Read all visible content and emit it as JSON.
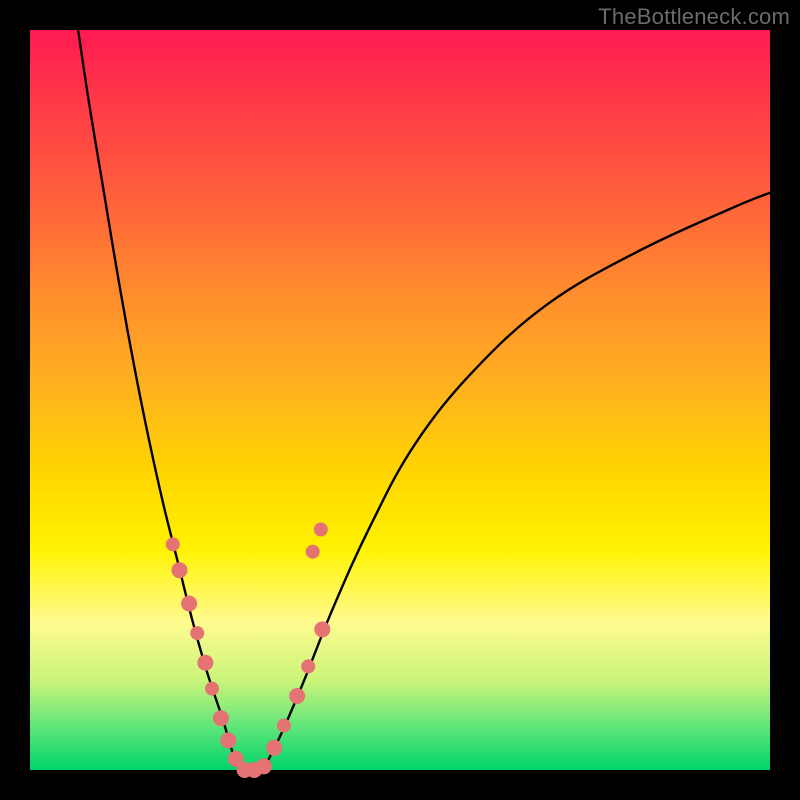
{
  "watermark": "TheBottleneck.com",
  "colors": {
    "curve_stroke": "#000000",
    "marker_fill": "#e57373",
    "marker_stroke": "#d86a6a",
    "frame": "#000000"
  },
  "chart_data": {
    "type": "line",
    "title": "",
    "xlabel": "",
    "ylabel": "",
    "x_range": [
      0,
      1
    ],
    "y_range_percent": [
      0,
      100
    ],
    "series": [
      {
        "name": "left_curve",
        "x": [
          0.065,
          0.08,
          0.1,
          0.12,
          0.14,
          0.16,
          0.18,
          0.2,
          0.22,
          0.24,
          0.26,
          0.275,
          0.285
        ],
        "y_percent": [
          100,
          90,
          78,
          66,
          55,
          45,
          36,
          28,
          20,
          13,
          7,
          2,
          0
        ]
      },
      {
        "name": "floor",
        "x": [
          0.285,
          0.3,
          0.315
        ],
        "y_percent": [
          0,
          0,
          0
        ]
      },
      {
        "name": "right_curve",
        "x": [
          0.315,
          0.34,
          0.37,
          0.41,
          0.46,
          0.52,
          0.6,
          0.7,
          0.82,
          0.95,
          1.0
        ],
        "y_percent": [
          0,
          5,
          12,
          22,
          33,
          44,
          54,
          63,
          70,
          76,
          78
        ]
      }
    ],
    "markers": [
      {
        "x": 0.193,
        "y_percent": 30.5,
        "r": 7
      },
      {
        "x": 0.202,
        "y_percent": 27.0,
        "r": 8
      },
      {
        "x": 0.215,
        "y_percent": 22.5,
        "r": 8
      },
      {
        "x": 0.226,
        "y_percent": 18.5,
        "r": 7
      },
      {
        "x": 0.237,
        "y_percent": 14.5,
        "r": 8
      },
      {
        "x": 0.246,
        "y_percent": 11.0,
        "r": 7
      },
      {
        "x": 0.258,
        "y_percent": 7.0,
        "r": 8
      },
      {
        "x": 0.268,
        "y_percent": 4.0,
        "r": 8
      },
      {
        "x": 0.278,
        "y_percent": 1.5,
        "r": 8
      },
      {
        "x": 0.29,
        "y_percent": 0.0,
        "r": 8
      },
      {
        "x": 0.303,
        "y_percent": 0.0,
        "r": 8
      },
      {
        "x": 0.316,
        "y_percent": 0.5,
        "r": 8
      },
      {
        "x": 0.33,
        "y_percent": 3.0,
        "r": 8
      },
      {
        "x": 0.343,
        "y_percent": 6.0,
        "r": 7
      },
      {
        "x": 0.361,
        "y_percent": 10.0,
        "r": 8
      },
      {
        "x": 0.376,
        "y_percent": 14.0,
        "r": 7
      },
      {
        "x": 0.395,
        "y_percent": 19.0,
        "r": 8
      },
      {
        "x": 0.382,
        "y_percent": 29.5,
        "r": 7
      },
      {
        "x": 0.393,
        "y_percent": 32.5,
        "r": 7
      }
    ]
  }
}
